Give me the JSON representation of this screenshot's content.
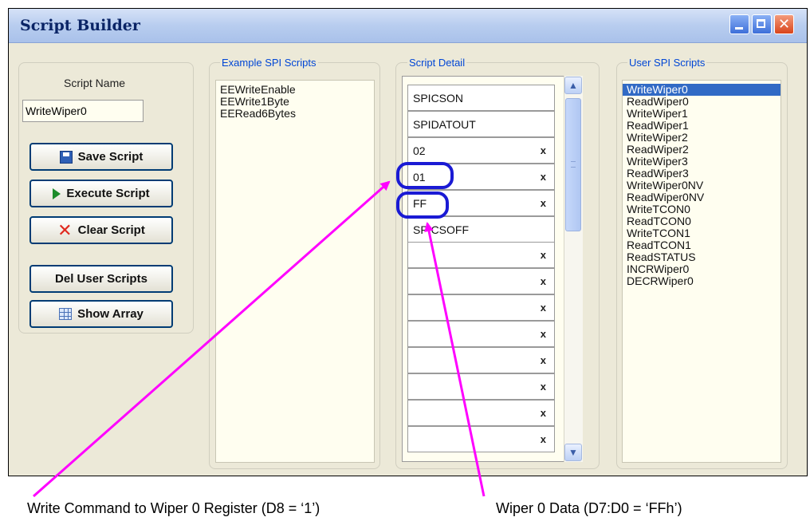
{
  "window": {
    "title": "Script Builder",
    "close_glyph": "✕"
  },
  "left_panel": {
    "script_name_label": "Script Name",
    "script_name_value": "WriteWiper0",
    "buttons": {
      "save": "Save Script",
      "execute": "Execute Script",
      "clear": "Clear Script",
      "del_user": "Del User Scripts",
      "show_array": "Show Array"
    }
  },
  "example_scripts": {
    "legend": "Example SPI Scripts",
    "items": [
      "EEWriteEnable",
      "EEWrite1Byte",
      "EERead6Bytes"
    ]
  },
  "script_detail": {
    "legend": "Script Detail",
    "delete_glyph": "x",
    "rows": [
      {
        "value": "SPICSON",
        "deletable": false
      },
      {
        "value": "SPIDATOUT",
        "deletable": false
      },
      {
        "value": "02",
        "deletable": true
      },
      {
        "value": "01",
        "deletable": true
      },
      {
        "value": "FF",
        "deletable": true
      },
      {
        "value": "SPICSOFF",
        "deletable": false
      },
      {
        "value": "",
        "deletable": true
      },
      {
        "value": "",
        "deletable": true
      },
      {
        "value": "",
        "deletable": true
      },
      {
        "value": "",
        "deletable": true
      },
      {
        "value": "",
        "deletable": true
      },
      {
        "value": "",
        "deletable": true
      },
      {
        "value": "",
        "deletable": true
      },
      {
        "value": "",
        "deletable": true
      }
    ],
    "scroll_up_glyph": "▲",
    "scroll_down_glyph": "▼"
  },
  "user_scripts": {
    "legend": "User SPI Scripts",
    "selected": "WriteWiper0",
    "items": [
      "WriteWiper0",
      "ReadWiper0",
      "WriteWiper1",
      "ReadWiper1",
      "WriteWiper2",
      "ReadWiper2",
      "WriteWiper3",
      "ReadWiper3",
      "WriteWiper0NV",
      "ReadWiper0NV",
      "WriteTCON0",
      "ReadTCON0",
      "WriteTCON1",
      "ReadTCON1",
      "ReadSTATUS",
      "INCRWiper0",
      "DECRWiper0"
    ]
  },
  "annotations": {
    "caption_left": "Write Command to Wiper 0 Register (D8 = ‘1’)",
    "caption_right": "Wiper 0 Data (D7:D0 = ‘FFh’)",
    "arrow_color": "#ff00ff",
    "highlight_color": "#1a1ad4"
  }
}
